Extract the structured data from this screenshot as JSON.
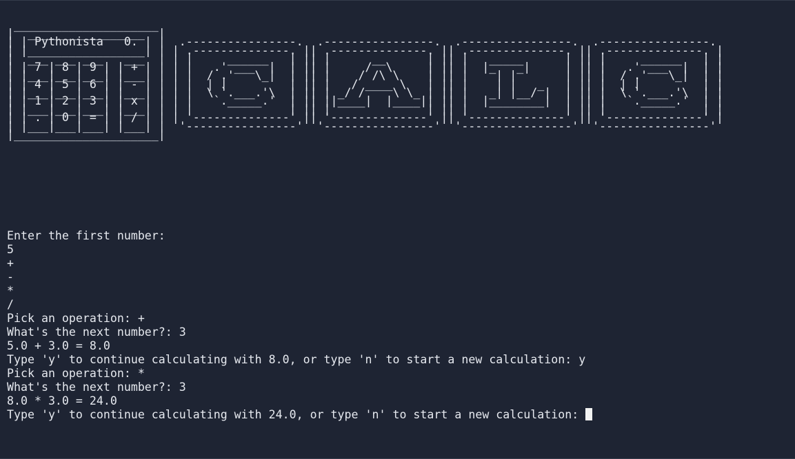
{
  "banner": {
    "calculator_display": "Pythonista   0.",
    "keys": [
      "7",
      "8",
      "9",
      "+",
      "4",
      "5",
      "6",
      "-",
      "1",
      "2",
      "3",
      "x",
      ".",
      "0",
      "=",
      "/"
    ],
    "title_letters": "CALC",
    "ascii_art": " _____________________\n|  _________________  |\n| | Pythonista   0. | |  .----------------.  .----------------.  .----------------.  .----------------.\n| |_________________| | | .--------------. || .--------------. || .--------------. || .--------------. |\n|  ___ ___ ___   ___  | | |     ______   | || |      __      | || |   _____      | || |     ______   | |\n| | 7 | 8 | 9 | | + | | | |   .' ___  |  | || |     /  \\     | || |  |_   _|     | || |   .' ___  |  | |\n| |___|___|___| |___| | | |  / .'   \\_|  | || |    / /\\ \\    | || |    | |       | || |  / .'   \\_|  | |\n| | 4 | 5 | 6 | | - | | | |  | |         | || |   / ____ \\   | || |    | |   _   | || |  | |         | |\n| |___|___|___| |___| | | |  \\ `.___.'\\  | || | _/ /    \\ \\_ | || |   _| |__/ |  | || |  \\ `.___.'\\  | |\n| | 1 | 2 | 3 | | x | | | |   `._____.'  | || ||____|  |____|| || |  |________|  | || |   `._____.'  | |\n| |___|___|___| |___| | | |              | || |              | || |              | || |              | |\n| | . | 0 | = | | / | | | '--------------' || '--------------' || '--------------' || '--------------' |\n| |___|___|___| |___| |  '----------------'  '----------------'  '----------------'  '----------------'\n|_____________________|"
  },
  "session": {
    "prompt_first": "Enter the first number: ",
    "input_first": "5",
    "operators": [
      "+",
      "-",
      "*",
      "/"
    ],
    "step1": {
      "pick_op_prompt": "Pick an operation: ",
      "op": "+",
      "next_prompt": "What's the next number?: ",
      "next_value": "3",
      "result_line": "5.0 + 3.0 = 8.0",
      "continue_prompt": "Type 'y' to continue calculating with 8.0, or type 'n' to start a new calculation: ",
      "continue_answer": "y"
    },
    "step2": {
      "pick_op_prompt": "Pick an operation: ",
      "op": "*",
      "next_prompt": "What's the next number?: ",
      "next_value": "3",
      "result_line": "8.0 * 3.0 = 24.0",
      "continue_prompt": "Type 'y' to continue calculating with 24.0, or type 'n' to start a new calculation: ",
      "continue_answer": ""
    }
  },
  "colors": {
    "background": "#1e2433",
    "foreground": "#e6e9ef",
    "cursor": "#f2f2f2"
  }
}
